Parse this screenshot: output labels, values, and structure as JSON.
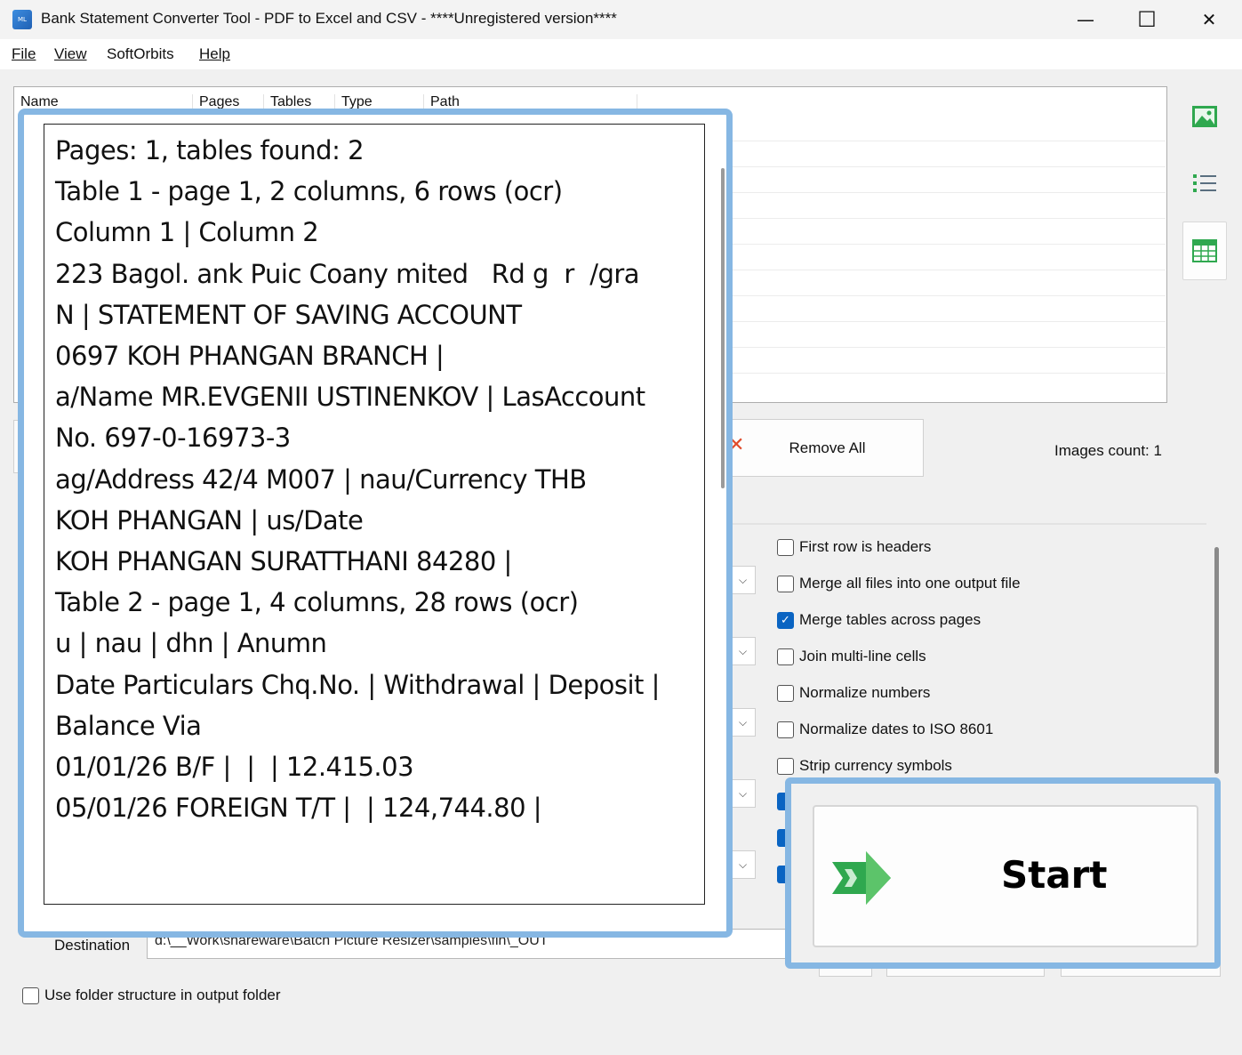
{
  "window": {
    "title": "Bank Statement Converter Tool - PDF to Excel and CSV - ****Unregistered version****",
    "minimize": "—",
    "maximize": "☐",
    "close": "✕"
  },
  "menu": {
    "file": "File",
    "view": "View",
    "softorbits": "SoftOrbits",
    "help": "Help"
  },
  "filelist": {
    "columns": [
      "Name",
      "Pages",
      "Tables",
      "Type",
      "Path"
    ]
  },
  "buttons": {
    "remove_all": "Remove All",
    "start": "Start"
  },
  "images_count": "Images count: 1",
  "options": [
    {
      "label": "First row is headers",
      "checked": false
    },
    {
      "label": "Merge all files into one output file",
      "checked": false
    },
    {
      "label": "Merge tables across pages",
      "checked": true
    },
    {
      "label": "Join multi-line cells",
      "checked": false
    },
    {
      "label": "Normalize numbers",
      "checked": false
    },
    {
      "label": "Normalize dates to ISO 8601",
      "checked": false
    },
    {
      "label": "Strip currency symbols",
      "checked": false
    }
  ],
  "destination": {
    "label": "Destination",
    "value": "d:\\__Work\\shareware\\Batch Picture Resizer\\samples\\fin\\_OUT"
  },
  "use_folder_structure": {
    "label": "Use folder structure in output folder",
    "checked": false
  },
  "preview": {
    "lines": [
      "Pages: 1, tables found: 2",
      "",
      "Table 1 - page 1, 2 columns, 6 rows (ocr)",
      "Column 1 | Column 2",
      "223 Bagol. ank Puic Coany mited   Rd g  r  /gra",
      "N | STATEMENT OF SAVING ACCOUNT",
      "0697 KOH PHANGAN BRANCH |",
      "a/Name MR.EVGENII USTINENKOV | LasAccount",
      "No. 697-0-16973-3",
      "ag/Address 42/4 M007 | nau/Currency THB",
      "KOH PHANGAN | us/Date",
      "KOH PHANGAN SURATTHANI 84280 |",
      "",
      "Table 2 - page 1, 4 columns, 28 rows (ocr)",
      "u | nau | dhn | Anumn",
      "Date Particulars Chq.No. | Withdrawal | Deposit |",
      "Balance Via",
      "01/01/26 B/F |  |  | 12.415.03",
      "05/01/26 FOREIGN T/T |  | 124,744.80 |"
    ]
  },
  "icons": {
    "app": "app-icon",
    "image_view": "image-icon",
    "list_view": "list-icon",
    "table_view": "table-icon",
    "start_arrow": "arrow-right-icon",
    "remove": "remove-icon"
  },
  "colors": {
    "highlight_border": "#86b7e3",
    "checkbox_on": "#0a64c2",
    "icon_green": "#2fa84f"
  }
}
